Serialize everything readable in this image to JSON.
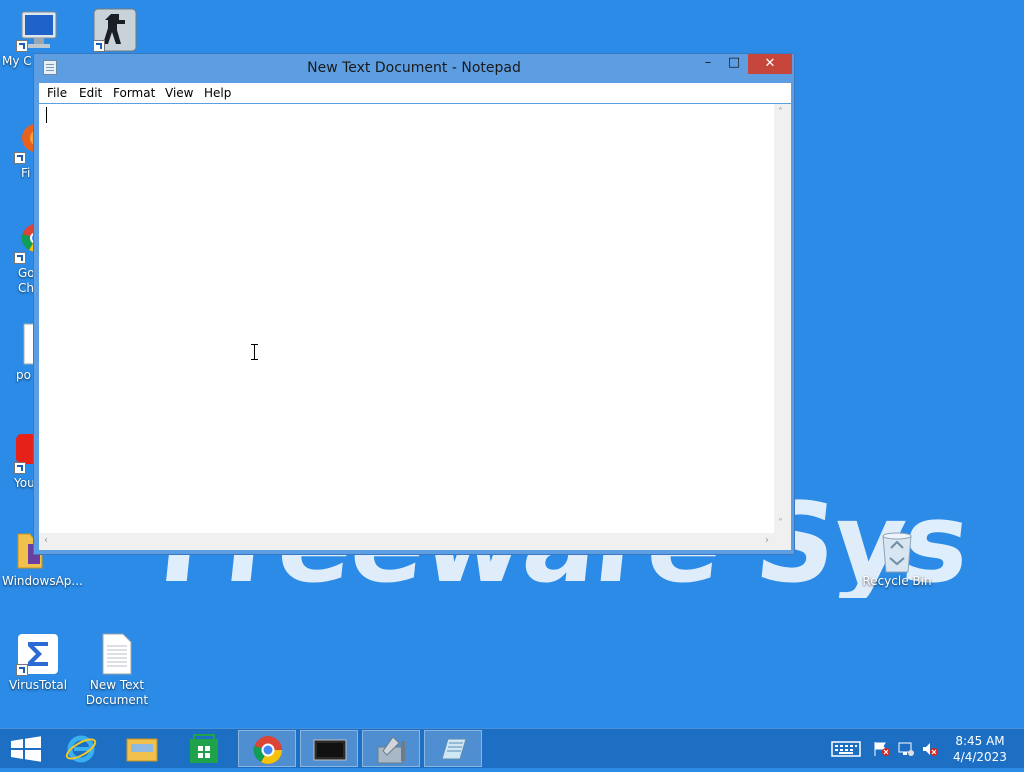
{
  "wallpaper": {
    "text": "Freeware Sys"
  },
  "desktop": {
    "icons": [
      {
        "label": "My C",
        "icon": "computer-icon"
      },
      {
        "label": "",
        "icon": "counter-strike-icon"
      },
      {
        "label": "Fi",
        "icon": "firefox-icon"
      },
      {
        "label": "Go\nCh",
        "icon": "chrome-icon"
      },
      {
        "label": "po",
        "icon": "file-icon"
      },
      {
        "label": "You",
        "icon": "youtube-icon"
      },
      {
        "label": "WindowsAp...",
        "icon": "folder-icon"
      },
      {
        "label": "VirusTotal",
        "icon": "virustotal-icon"
      },
      {
        "label": "New Text\nDocument",
        "icon": "text-document-icon"
      },
      {
        "label": "Recycle Bin",
        "icon": "recycle-bin-icon"
      }
    ]
  },
  "window": {
    "title": "New Text Document - Notepad",
    "controls": {
      "minimize": "–",
      "maximize": "□",
      "close": "✕"
    },
    "menu": [
      "File",
      "Edit",
      "Format",
      "View",
      "Help"
    ],
    "content": ""
  },
  "taskbar": {
    "apps": [
      {
        "name": "start",
        "icon": "windows-logo-icon"
      },
      {
        "name": "internet-explorer",
        "icon": "ie-icon"
      },
      {
        "name": "file-explorer",
        "icon": "folder-icon"
      },
      {
        "name": "store",
        "icon": "store-icon"
      },
      {
        "name": "chrome",
        "icon": "chrome-icon"
      },
      {
        "name": "terminal",
        "icon": "monitor-icon"
      },
      {
        "name": "tools",
        "icon": "tools-icon"
      },
      {
        "name": "notepad",
        "icon": "notepad-icon"
      }
    ],
    "clock": {
      "time": "8:45 AM",
      "date": "4/4/2023"
    }
  },
  "colors": {
    "desktop": "#2b8be6",
    "taskbar": "#1d6fc4",
    "close": "#c7463c"
  }
}
